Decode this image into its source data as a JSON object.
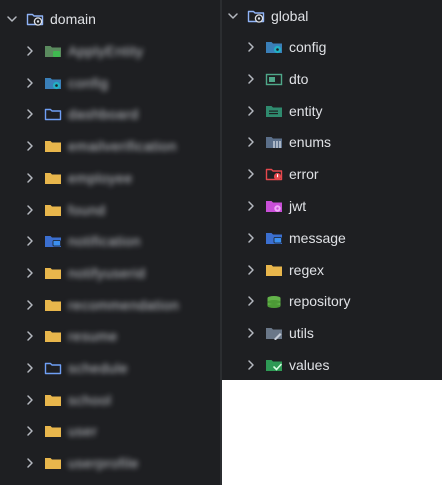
{
  "colors": {
    "panel_bg": "#1e1f22",
    "text": "#dfe1e5",
    "chevron": "#b4b8bf",
    "folder_yellow": "#e8b64c",
    "folder_blue_outline": "#6f9ff5",
    "badge_green": "#3fb950",
    "badge_teal": "#22b0c4",
    "badge_red": "#e5484d",
    "badge_magenta": "#c94fd8",
    "badge_blue": "#3b8ff0"
  },
  "left_tree": {
    "root": {
      "label": "domain",
      "icon": "package-folder-icon",
      "expanded": true
    },
    "items": [
      {
        "label": "ApplyEntity",
        "icon": "green-folder-icon"
      },
      {
        "label": "config",
        "icon": "config-folder-icon"
      },
      {
        "label": "dashboard",
        "icon": "blue-outline-folder-icon"
      },
      {
        "label": "emailverification",
        "icon": "yellow-folder-icon"
      },
      {
        "label": "employee",
        "icon": "yellow-folder-icon"
      },
      {
        "label": "found",
        "icon": "yellow-folder-icon"
      },
      {
        "label": "notification",
        "icon": "message-folder-icon"
      },
      {
        "label": "notifyuserid",
        "icon": "yellow-folder-icon"
      },
      {
        "label": "recommendation",
        "icon": "yellow-folder-icon"
      },
      {
        "label": "resume",
        "icon": "yellow-folder-icon"
      },
      {
        "label": "schedule",
        "icon": "blue-outline-folder-icon"
      },
      {
        "label": "school",
        "icon": "yellow-folder-icon"
      },
      {
        "label": "user",
        "icon": "yellow-folder-icon"
      },
      {
        "label": "userprofile",
        "icon": "yellow-folder-icon"
      }
    ]
  },
  "right_tree": {
    "root": {
      "label": "global",
      "icon": "package-folder-icon",
      "expanded": true
    },
    "items": [
      {
        "label": "config",
        "icon": "config-folder-icon"
      },
      {
        "label": "dto",
        "icon": "dto-folder-icon"
      },
      {
        "label": "entity",
        "icon": "entity-folder-icon"
      },
      {
        "label": "enums",
        "icon": "enums-folder-icon"
      },
      {
        "label": "error",
        "icon": "error-folder-icon"
      },
      {
        "label": "jwt",
        "icon": "jwt-folder-icon"
      },
      {
        "label": "message",
        "icon": "message-folder-icon"
      },
      {
        "label": "regex",
        "icon": "yellow-folder-icon"
      },
      {
        "label": "repository",
        "icon": "repository-folder-icon"
      },
      {
        "label": "utils",
        "icon": "utils-folder-icon"
      },
      {
        "label": "values",
        "icon": "values-folder-icon"
      }
    ]
  }
}
